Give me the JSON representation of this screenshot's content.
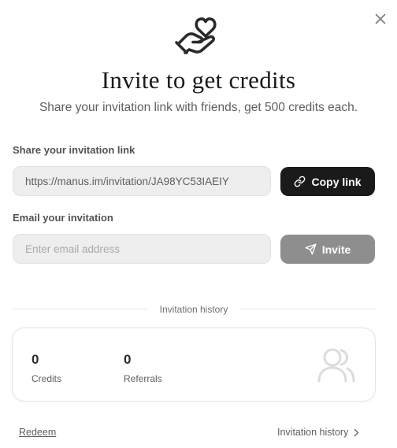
{
  "dialog": {
    "title": "Invite to get credits",
    "subtitle": "Share your invitation link with friends, get 500 credits each.",
    "icons": {
      "hero": "hand-heart-icon",
      "close": "close-icon",
      "copy": "link-icon",
      "invite": "send-icon",
      "users": "users-icon",
      "chevron": "chevron-right-icon"
    }
  },
  "share": {
    "label": "Share your invitation link",
    "link_value": "https://manus.im/invitation/JA98YC53IAEIY",
    "copy_button": "Copy link"
  },
  "email": {
    "label": "Email your invitation",
    "placeholder": "Enter email address",
    "value": "",
    "invite_button": "Invite"
  },
  "history": {
    "divider_label": "Invitation history",
    "stats": [
      {
        "value": "0",
        "label": "Credits"
      },
      {
        "value": "0",
        "label": "Referrals"
      }
    ]
  },
  "footer": {
    "redeem": "Redeem",
    "history_link": "Invitation history"
  },
  "colors": {
    "primary_button": "#1a1a1a",
    "disabled_button": "#8e8e8e",
    "field_background": "#eeeeee"
  }
}
